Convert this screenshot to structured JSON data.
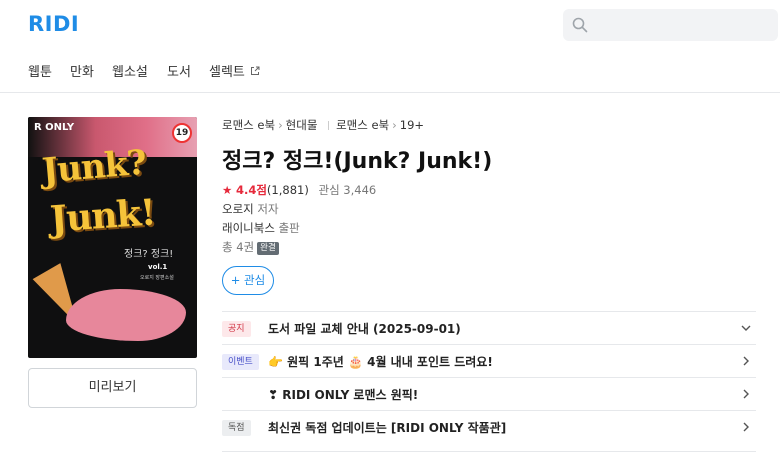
{
  "header": {
    "logo": "RIDI",
    "search_placeholder": "",
    "icons": {
      "search": "search-icon",
      "external": "external-link-icon",
      "more": "more-icon"
    }
  },
  "nav": {
    "items": [
      "웹툰",
      "만화",
      "웹소설",
      "도서",
      "셀렉트"
    ],
    "more": "⋮"
  },
  "cover": {
    "badge_ronly": "R ONLY",
    "badge_age": "19",
    "title_line1": "Junk?",
    "title_line2": "Junk!",
    "subtitle": "정크? 정크!",
    "vol": "vol.1",
    "author": "오로지 장편소설"
  },
  "preview_button": "미리보기",
  "book": {
    "breadcrumbs": [
      "로맨스 e북",
      "현대물",
      "로맨스 e북",
      "19+"
    ],
    "title": "정크? 정크!(Junk? Junk!)",
    "rating_star": "★",
    "rating": "4.4점",
    "rating_count": "(1,881)",
    "interest": "관심 3,446",
    "author_name": "오로지",
    "author_role": "저자",
    "publisher_name": "래이니북스",
    "publisher_role": "출판",
    "volumes": "총 4권",
    "status_tag": "완결",
    "follow_label": "+ 관심"
  },
  "notices": [
    {
      "tag": "공지",
      "text": "도서 파일 교체 안내 (2025-09-01)",
      "chevron": "chevron-down-icon"
    },
    {
      "tag": "이벤트",
      "text": "👉 원픽 1주년 🎂 4월 내내 포인트 드려요!",
      "chevron": "chevron-right-icon"
    },
    {
      "tag": "",
      "text": "❣ RIDI ONLY 로맨스 원픽!",
      "chevron": "chevron-right-icon"
    },
    {
      "tag": "독점",
      "text": "최신권 독점 업데이트는 [RIDI ONLY 작품관]",
      "chevron": "chevron-right-icon"
    }
  ],
  "colors": {
    "brand": "#1f8ce6",
    "rating": "#e6293b"
  }
}
